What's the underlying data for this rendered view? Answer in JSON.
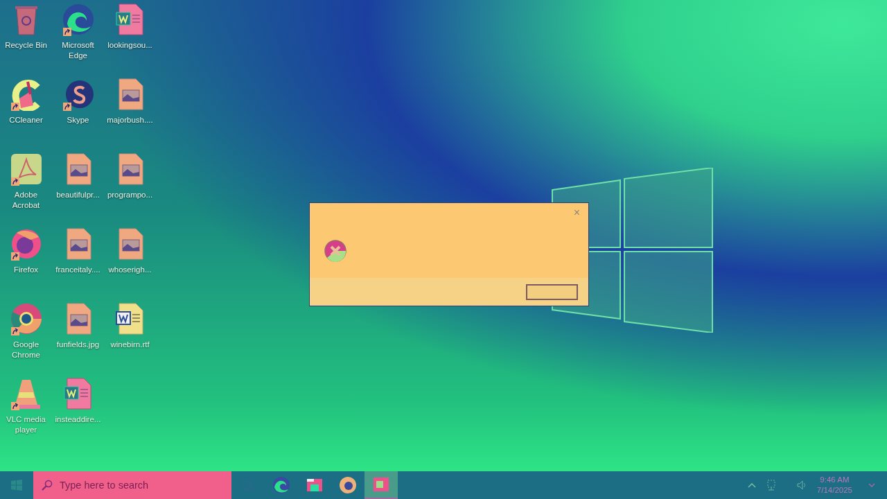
{
  "desktop_icons": [
    {
      "label": "Recycle Bin",
      "kind": "recycle",
      "shortcut": false
    },
    {
      "label": "CCleaner",
      "kind": "ccleaner",
      "shortcut": true
    },
    {
      "label": "Adobe Acrobat",
      "kind": "acrobat",
      "shortcut": true
    },
    {
      "label": "Firefox",
      "kind": "firefox",
      "shortcut": true
    },
    {
      "label": "Google Chrome",
      "kind": "chrome",
      "shortcut": true
    },
    {
      "label": "VLC media player",
      "kind": "vlc",
      "shortcut": true
    },
    {
      "label": "Microsoft Edge",
      "kind": "edge",
      "shortcut": true
    },
    {
      "label": "Skype",
      "kind": "skype",
      "shortcut": true
    },
    {
      "label": "beautifulpr...",
      "kind": "image",
      "shortcut": false
    },
    {
      "label": "franceitaly....",
      "kind": "image",
      "shortcut": false
    },
    {
      "label": "funfields.jpg",
      "kind": "image",
      "shortcut": false
    },
    {
      "label": "insteaddire...",
      "kind": "worddoc",
      "shortcut": false
    },
    {
      "label": "lookingsou...",
      "kind": "worddoc",
      "shortcut": false
    },
    {
      "label": "majorbush....",
      "kind": "image",
      "shortcut": false
    },
    {
      "label": "programpo...",
      "kind": "image",
      "shortcut": false
    },
    {
      "label": "whoserigh...",
      "kind": "image",
      "shortcut": false
    },
    {
      "label": "winebirn.rtf",
      "kind": "word",
      "shortcut": false
    }
  ],
  "dialog": {
    "close": "×"
  },
  "taskbar": {
    "search": {
      "placeholder": "Type here to search"
    },
    "apps": [
      {
        "kind": "edge",
        "selected": false
      },
      {
        "kind": "folder",
        "selected": false
      },
      {
        "kind": "firefox",
        "selected": false
      },
      {
        "kind": "app",
        "selected": true
      }
    ],
    "clock": {
      "time": "9:46 AM",
      "date": "7/14/2025"
    }
  }
}
